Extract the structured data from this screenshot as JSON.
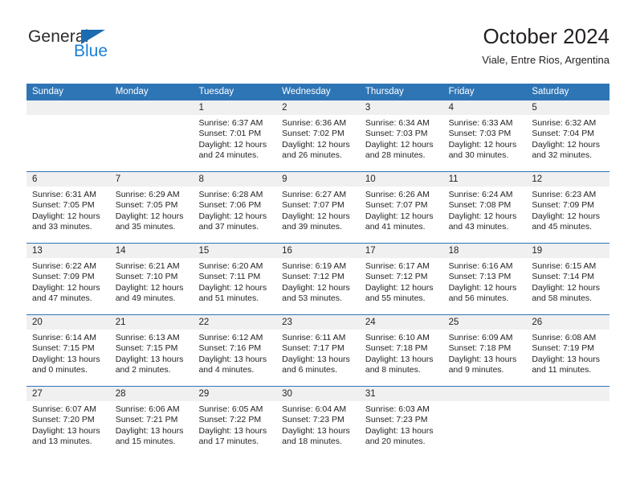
{
  "brand": {
    "name_dark": "General",
    "name_blue": "Blue",
    "triangle_icon": "triangle-icon"
  },
  "header": {
    "title": "October 2024",
    "subtitle": "Viale, Entre Rios, Argentina"
  },
  "colors": {
    "header_blue": "#2e75b6",
    "daynum_band": "#f0f0f0",
    "brand_blue": "#1b7fd4",
    "triangle_blue": "#1b6cb0",
    "text": "#231f20"
  },
  "weekdays": [
    "Sunday",
    "Monday",
    "Tuesday",
    "Wednesday",
    "Thursday",
    "Friday",
    "Saturday"
  ],
  "weeks": [
    [
      {
        "day": "",
        "lines": []
      },
      {
        "day": "",
        "lines": []
      },
      {
        "day": "1",
        "lines": [
          "Sunrise: 6:37 AM",
          "Sunset: 7:01 PM",
          "Daylight: 12 hours",
          "and 24 minutes."
        ]
      },
      {
        "day": "2",
        "lines": [
          "Sunrise: 6:36 AM",
          "Sunset: 7:02 PM",
          "Daylight: 12 hours",
          "and 26 minutes."
        ]
      },
      {
        "day": "3",
        "lines": [
          "Sunrise: 6:34 AM",
          "Sunset: 7:03 PM",
          "Daylight: 12 hours",
          "and 28 minutes."
        ]
      },
      {
        "day": "4",
        "lines": [
          "Sunrise: 6:33 AM",
          "Sunset: 7:03 PM",
          "Daylight: 12 hours",
          "and 30 minutes."
        ]
      },
      {
        "day": "5",
        "lines": [
          "Sunrise: 6:32 AM",
          "Sunset: 7:04 PM",
          "Daylight: 12 hours",
          "and 32 minutes."
        ]
      }
    ],
    [
      {
        "day": "6",
        "lines": [
          "Sunrise: 6:31 AM",
          "Sunset: 7:05 PM",
          "Daylight: 12 hours",
          "and 33 minutes."
        ]
      },
      {
        "day": "7",
        "lines": [
          "Sunrise: 6:29 AM",
          "Sunset: 7:05 PM",
          "Daylight: 12 hours",
          "and 35 minutes."
        ]
      },
      {
        "day": "8",
        "lines": [
          "Sunrise: 6:28 AM",
          "Sunset: 7:06 PM",
          "Daylight: 12 hours",
          "and 37 minutes."
        ]
      },
      {
        "day": "9",
        "lines": [
          "Sunrise: 6:27 AM",
          "Sunset: 7:07 PM",
          "Daylight: 12 hours",
          "and 39 minutes."
        ]
      },
      {
        "day": "10",
        "lines": [
          "Sunrise: 6:26 AM",
          "Sunset: 7:07 PM",
          "Daylight: 12 hours",
          "and 41 minutes."
        ]
      },
      {
        "day": "11",
        "lines": [
          "Sunrise: 6:24 AM",
          "Sunset: 7:08 PM",
          "Daylight: 12 hours",
          "and 43 minutes."
        ]
      },
      {
        "day": "12",
        "lines": [
          "Sunrise: 6:23 AM",
          "Sunset: 7:09 PM",
          "Daylight: 12 hours",
          "and 45 minutes."
        ]
      }
    ],
    [
      {
        "day": "13",
        "lines": [
          "Sunrise: 6:22 AM",
          "Sunset: 7:09 PM",
          "Daylight: 12 hours",
          "and 47 minutes."
        ]
      },
      {
        "day": "14",
        "lines": [
          "Sunrise: 6:21 AM",
          "Sunset: 7:10 PM",
          "Daylight: 12 hours",
          "and 49 minutes."
        ]
      },
      {
        "day": "15",
        "lines": [
          "Sunrise: 6:20 AM",
          "Sunset: 7:11 PM",
          "Daylight: 12 hours",
          "and 51 minutes."
        ]
      },
      {
        "day": "16",
        "lines": [
          "Sunrise: 6:19 AM",
          "Sunset: 7:12 PM",
          "Daylight: 12 hours",
          "and 53 minutes."
        ]
      },
      {
        "day": "17",
        "lines": [
          "Sunrise: 6:17 AM",
          "Sunset: 7:12 PM",
          "Daylight: 12 hours",
          "and 55 minutes."
        ]
      },
      {
        "day": "18",
        "lines": [
          "Sunrise: 6:16 AM",
          "Sunset: 7:13 PM",
          "Daylight: 12 hours",
          "and 56 minutes."
        ]
      },
      {
        "day": "19",
        "lines": [
          "Sunrise: 6:15 AM",
          "Sunset: 7:14 PM",
          "Daylight: 12 hours",
          "and 58 minutes."
        ]
      }
    ],
    [
      {
        "day": "20",
        "lines": [
          "Sunrise: 6:14 AM",
          "Sunset: 7:15 PM",
          "Daylight: 13 hours",
          "and 0 minutes."
        ]
      },
      {
        "day": "21",
        "lines": [
          "Sunrise: 6:13 AM",
          "Sunset: 7:15 PM",
          "Daylight: 13 hours",
          "and 2 minutes."
        ]
      },
      {
        "day": "22",
        "lines": [
          "Sunrise: 6:12 AM",
          "Sunset: 7:16 PM",
          "Daylight: 13 hours",
          "and 4 minutes."
        ]
      },
      {
        "day": "23",
        "lines": [
          "Sunrise: 6:11 AM",
          "Sunset: 7:17 PM",
          "Daylight: 13 hours",
          "and 6 minutes."
        ]
      },
      {
        "day": "24",
        "lines": [
          "Sunrise: 6:10 AM",
          "Sunset: 7:18 PM",
          "Daylight: 13 hours",
          "and 8 minutes."
        ]
      },
      {
        "day": "25",
        "lines": [
          "Sunrise: 6:09 AM",
          "Sunset: 7:18 PM",
          "Daylight: 13 hours",
          "and 9 minutes."
        ]
      },
      {
        "day": "26",
        "lines": [
          "Sunrise: 6:08 AM",
          "Sunset: 7:19 PM",
          "Daylight: 13 hours",
          "and 11 minutes."
        ]
      }
    ],
    [
      {
        "day": "27",
        "lines": [
          "Sunrise: 6:07 AM",
          "Sunset: 7:20 PM",
          "Daylight: 13 hours",
          "and 13 minutes."
        ]
      },
      {
        "day": "28",
        "lines": [
          "Sunrise: 6:06 AM",
          "Sunset: 7:21 PM",
          "Daylight: 13 hours",
          "and 15 minutes."
        ]
      },
      {
        "day": "29",
        "lines": [
          "Sunrise: 6:05 AM",
          "Sunset: 7:22 PM",
          "Daylight: 13 hours",
          "and 17 minutes."
        ]
      },
      {
        "day": "30",
        "lines": [
          "Sunrise: 6:04 AM",
          "Sunset: 7:23 PM",
          "Daylight: 13 hours",
          "and 18 minutes."
        ]
      },
      {
        "day": "31",
        "lines": [
          "Sunrise: 6:03 AM",
          "Sunset: 7:23 PM",
          "Daylight: 13 hours",
          "and 20 minutes."
        ]
      },
      {
        "day": "",
        "lines": []
      },
      {
        "day": "",
        "lines": []
      }
    ]
  ]
}
